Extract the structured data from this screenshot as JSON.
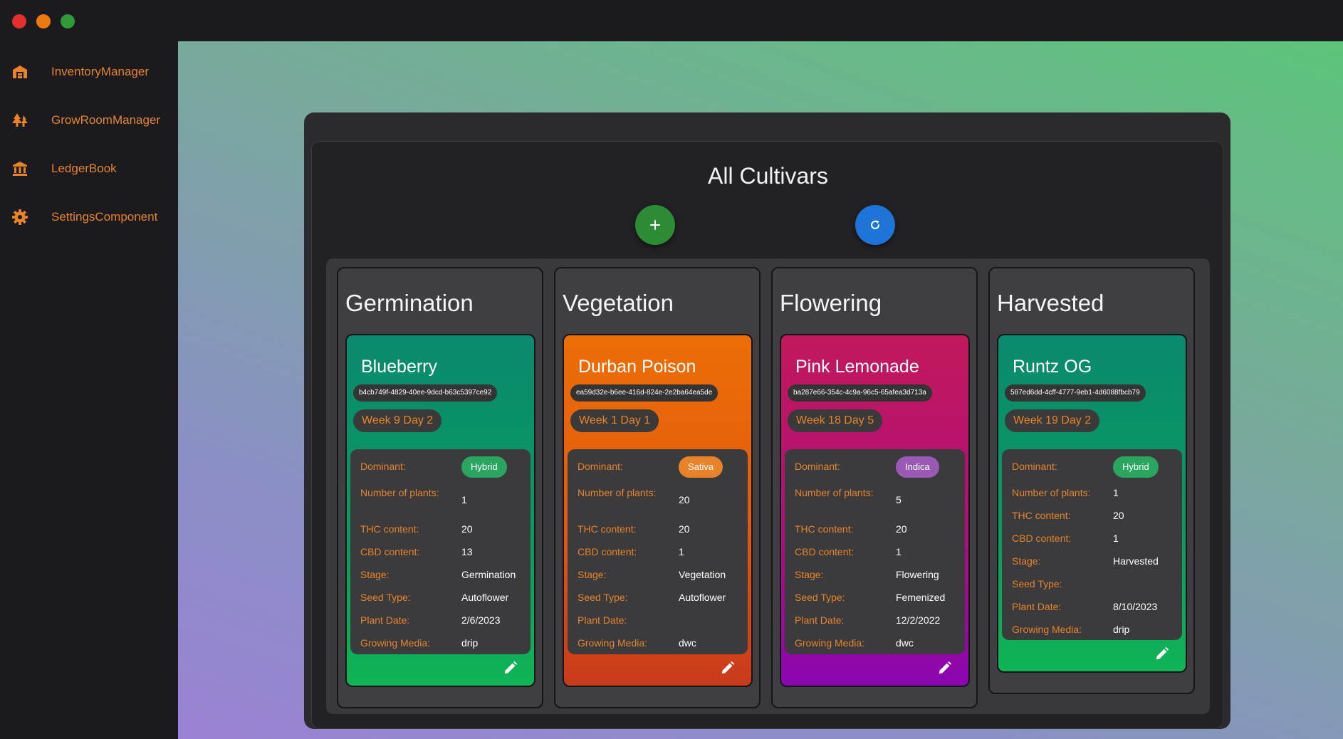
{
  "colors": {
    "accent": "#e8832a",
    "hybrid": "#2aa660",
    "sativa": "#e8832a",
    "indica": "#9b59b6",
    "add_button": "#2e8b35",
    "refresh_button": "#1f74d8"
  },
  "sidebar": {
    "items": [
      {
        "label": "InventoryManager",
        "icon": "warehouse-icon"
      },
      {
        "label": "GrowRoomManager",
        "icon": "trees-icon"
      },
      {
        "label": "LedgerBook",
        "icon": "bank-icon"
      },
      {
        "label": "SettingsComponent",
        "icon": "gear-icon"
      }
    ]
  },
  "page": {
    "title": "All Cultivars",
    "add_icon": "plus-icon",
    "refresh_icon": "refresh-icon"
  },
  "labels": {
    "dominant": "Dominant:",
    "plants": "Number of plants:",
    "thc": "THC content:",
    "cbd": "CBD content:",
    "stage": "Stage:",
    "seed_type": "Seed Type:",
    "plant_date": "Plant Date:",
    "growing_media": "Growing Media:"
  },
  "columns": [
    {
      "title": "Germination",
      "card": {
        "name": "Blueberry",
        "id": "b4cb749f-4829-40ee-9dcd-b63c5397ce92",
        "week": "Week 9 Day 2",
        "dominant": "Hybrid",
        "plants": "1",
        "thc": "20",
        "cbd": "13",
        "stage": "Germination",
        "seed_type": "Autoflower",
        "plant_date": "2/6/2023",
        "growing_media": "drip"
      }
    },
    {
      "title": "Vegetation",
      "card": {
        "name": "Durban Poison",
        "id": "ea59d32e-b6ee-416d-824e-2e2ba64ea5de",
        "week": "Week 1 Day 1",
        "dominant": "Sativa",
        "plants": "20",
        "thc": "20",
        "cbd": "1",
        "stage": "Vegetation",
        "seed_type": "Autoflower",
        "plant_date": "",
        "growing_media": "dwc"
      }
    },
    {
      "title": "Flowering",
      "card": {
        "name": "Pink Lemonade",
        "id": "ba287e66-354c-4c9a-96c5-65afea3d713a",
        "week": "Week 18 Day 5",
        "dominant": "Indica",
        "plants": "5",
        "thc": "20",
        "cbd": "1",
        "stage": "Flowering",
        "seed_type": "Femenized",
        "plant_date": "12/2/2022",
        "growing_media": "dwc"
      }
    },
    {
      "title": "Harvested",
      "card": {
        "name": "Runtz OG",
        "id": "587ed6dd-4cff-4777-9eb1-4d6088fbcb79",
        "week": "Week 19 Day 2",
        "dominant": "Hybrid",
        "plants": "1",
        "thc": "20",
        "cbd": "1",
        "stage": "Harvested",
        "seed_type": "",
        "plant_date": "8/10/2023",
        "growing_media": "drip"
      }
    }
  ]
}
